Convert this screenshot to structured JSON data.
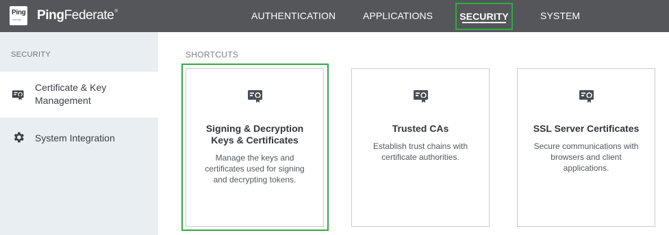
{
  "brand": {
    "badge_top": "Ping",
    "badge_bottom": "Identity",
    "name_bold": "Ping",
    "name_regular": "Federate",
    "trademark": "®"
  },
  "nav": {
    "items": [
      {
        "label": "AUTHENTICATION"
      },
      {
        "label": "APPLICATIONS"
      },
      {
        "label": "SECURITY",
        "active": true
      },
      {
        "label": "SYSTEM"
      }
    ]
  },
  "sidebar": {
    "section_title": "SECURITY",
    "items": [
      {
        "label_line1": "Certificate & Key",
        "label_line2": "Management",
        "icon": "certificate-icon",
        "active": true
      },
      {
        "label": "System Integration",
        "icon": "gear-icon"
      }
    ]
  },
  "main": {
    "shortcuts_title": "SHORTCUTS",
    "cards": [
      {
        "title_line1": "Signing & Decryption",
        "title_line2": "Keys & Certificates",
        "desc_line1": "Manage the keys and",
        "desc_line2": "certificates used for signing",
        "desc_line3": "and decrypting tokens.",
        "icon": "certificate-icon"
      },
      {
        "title": "Trusted CAs",
        "desc_line1": "Establish trust chains with",
        "desc_line2": "certificate authorities.",
        "icon": "certificate-icon"
      },
      {
        "title": "SSL Server Certificates",
        "desc_line1": "Secure communications with",
        "desc_line2": "browsers and client",
        "desc_line3": "applications.",
        "icon": "certificate-icon"
      }
    ]
  },
  "colors": {
    "topbar": "#545659",
    "highlight": "#2faa44",
    "sidebar_bg": "#e9eef2"
  }
}
